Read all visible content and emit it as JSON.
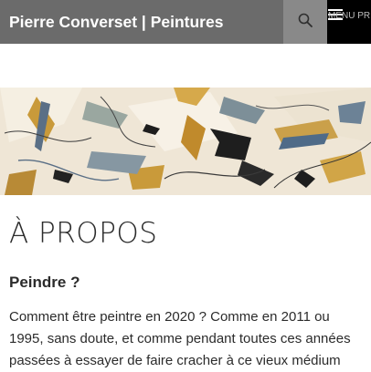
{
  "header": {
    "site_title": "Pierre Converset | Peintures",
    "search_icon": "search-icon",
    "menu_icon": "hamburger-icon",
    "menu_label": "Menu principal"
  },
  "hero": {
    "image": "abstract-painting-banner",
    "palette": [
      "#efe6d6",
      "#c99a3a",
      "#5a6f86",
      "#1e1e1e",
      "#9aa7a0"
    ]
  },
  "article": {
    "title": "À PROPOS",
    "heading": "Peindre ?",
    "body": "Comment être peintre en 2020 ? Comme en 2011 ou 1995, sans doute, et comme pendant toutes ces années passées à essayer de faire cracher à ce vieux médium"
  },
  "colors": {
    "header_bg": "#6b6b6b",
    "search_bg": "#898989",
    "menu_bg": "#000000",
    "text": "#2b2b2b"
  }
}
